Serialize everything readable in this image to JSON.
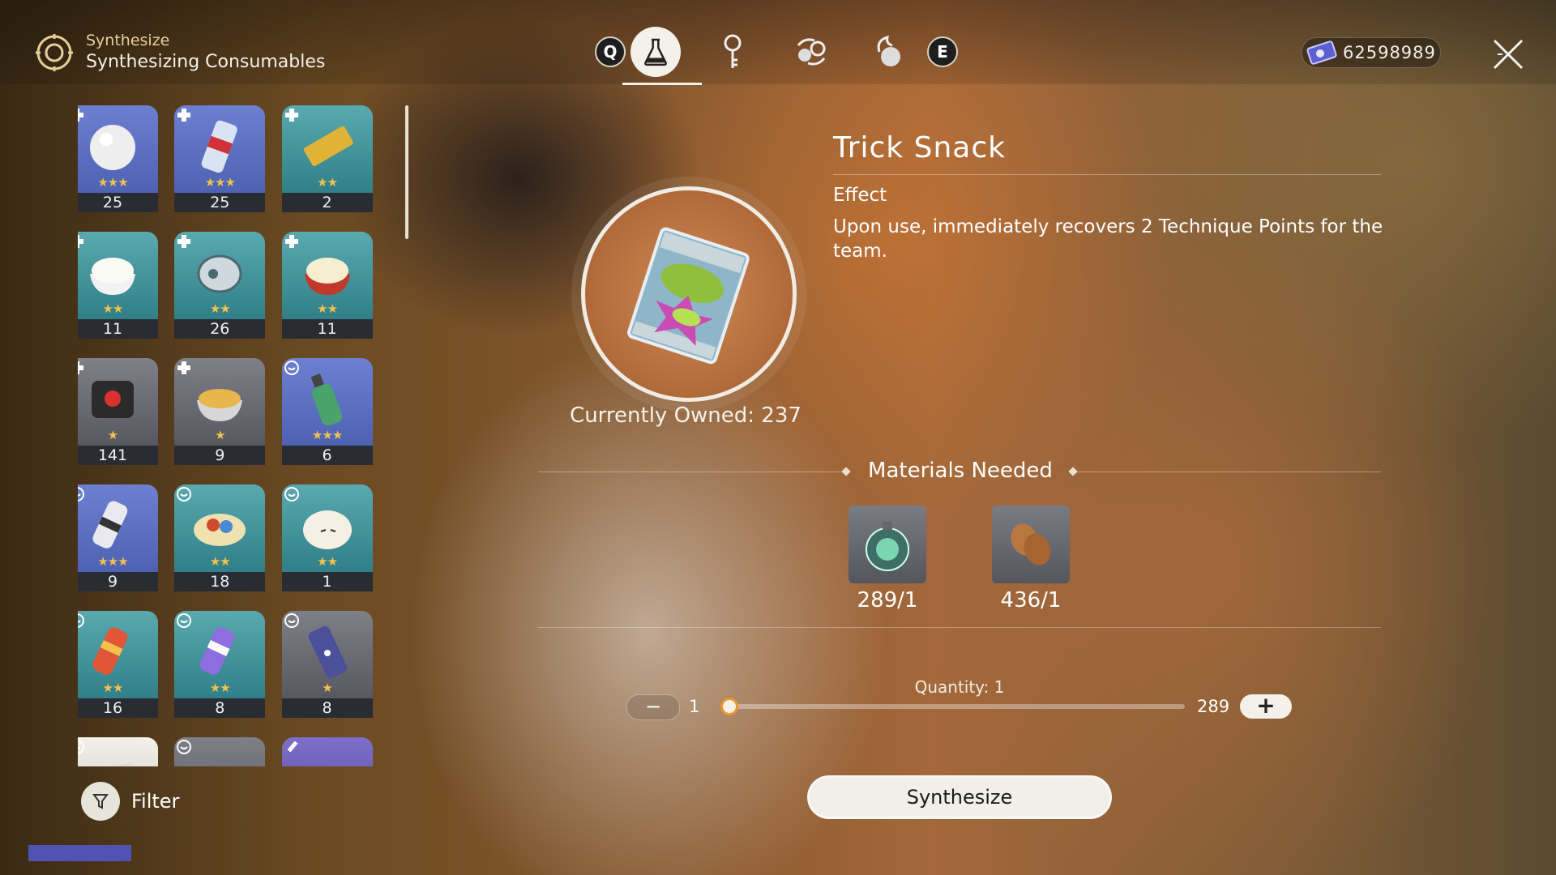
{
  "header": {
    "category": "Synthesize",
    "subtitle": "Synthesizing Consumables",
    "tab_left_key": "Q",
    "tab_right_key": "E",
    "tabs": [
      "consumables-flask-icon",
      "key-icon",
      "recycle-icon",
      "fire-orb-icon"
    ],
    "active_tab_index": 0
  },
  "currency": {
    "icon": "stellar-jade-ticket-icon",
    "value": "62598989"
  },
  "items": [
    {
      "count": "25",
      "stars": "★★★",
      "badge": "plus-icon",
      "tile": "blue",
      "art": "white-orb"
    },
    {
      "count": "25",
      "stars": "★★★",
      "badge": "plus-icon",
      "tile": "blue",
      "art": "can"
    },
    {
      "count": "2",
      "stars": "★★",
      "badge": "plus-icon",
      "tile": "teal",
      "art": "bar"
    },
    {
      "count": "11",
      "stars": "★★",
      "badge": "plus-icon",
      "tile": "teal",
      "art": "rice"
    },
    {
      "count": "26",
      "stars": "★★",
      "badge": "plus-icon",
      "tile": "teal",
      "art": "mask"
    },
    {
      "count": "11",
      "stars": "★★",
      "badge": "plus-icon",
      "tile": "teal",
      "art": "rice-red"
    },
    {
      "count": "141",
      "stars": "★",
      "badge": "plus-icon",
      "tile": "gray",
      "art": "device"
    },
    {
      "count": "9",
      "stars": "★",
      "badge": "plus-icon",
      "tile": "gray",
      "art": "bowl"
    },
    {
      "count": "6",
      "stars": "★★★",
      "badge": "swirl-icon",
      "tile": "blue",
      "art": "bottle"
    },
    {
      "count": "9",
      "stars": "★★★",
      "badge": "swirl-icon",
      "tile": "blue",
      "art": "bottle-striped"
    },
    {
      "count": "18",
      "stars": "★★",
      "badge": "swirl-icon",
      "tile": "teal",
      "art": "plate"
    },
    {
      "count": "1",
      "stars": "★★",
      "badge": "swirl-icon",
      "tile": "teal",
      "art": "bun"
    },
    {
      "count": "16",
      "stars": "★★",
      "badge": "swirl-icon",
      "tile": "teal",
      "art": "bottle-red"
    },
    {
      "count": "8",
      "stars": "★★",
      "badge": "swirl-icon",
      "tile": "teal",
      "art": "bottle-purple"
    },
    {
      "count": "8",
      "stars": "★",
      "badge": "swirl-icon",
      "tile": "gray",
      "art": "tumbler"
    },
    {
      "count": "",
      "stars": "",
      "badge": "swirl-icon",
      "tile": "gray",
      "art": "snack"
    },
    {
      "count": "",
      "stars": "",
      "badge": "swirl-icon",
      "tile": "gray",
      "art": "unknown"
    },
    {
      "count": "",
      "stars": "",
      "badge": "pencil-icon",
      "tile": "purple",
      "art": "unknown"
    }
  ],
  "filter": {
    "label": "Filter"
  },
  "detail": {
    "name": "Trick Snack",
    "effect_label": "Effect",
    "effect_text": "Upon use, immediately recovers 2 Technique Points for the team.",
    "owned_text": "Currently Owned: 237"
  },
  "materials": {
    "title": "Materials Needed",
    "items": [
      {
        "icon": "green-potion-icon",
        "amount": "289/1"
      },
      {
        "icon": "beans-icon",
        "amount": "436/1"
      }
    ]
  },
  "quantity": {
    "label": "Quantity: 1",
    "min": "1",
    "max": "289",
    "value": 1,
    "minus": "−",
    "plus": "+"
  },
  "synthesize_button": "Synthesize",
  "colors": {
    "accent": "#e9962e",
    "star": "#f2c14e",
    "header_gold": "#e7cf9b"
  }
}
